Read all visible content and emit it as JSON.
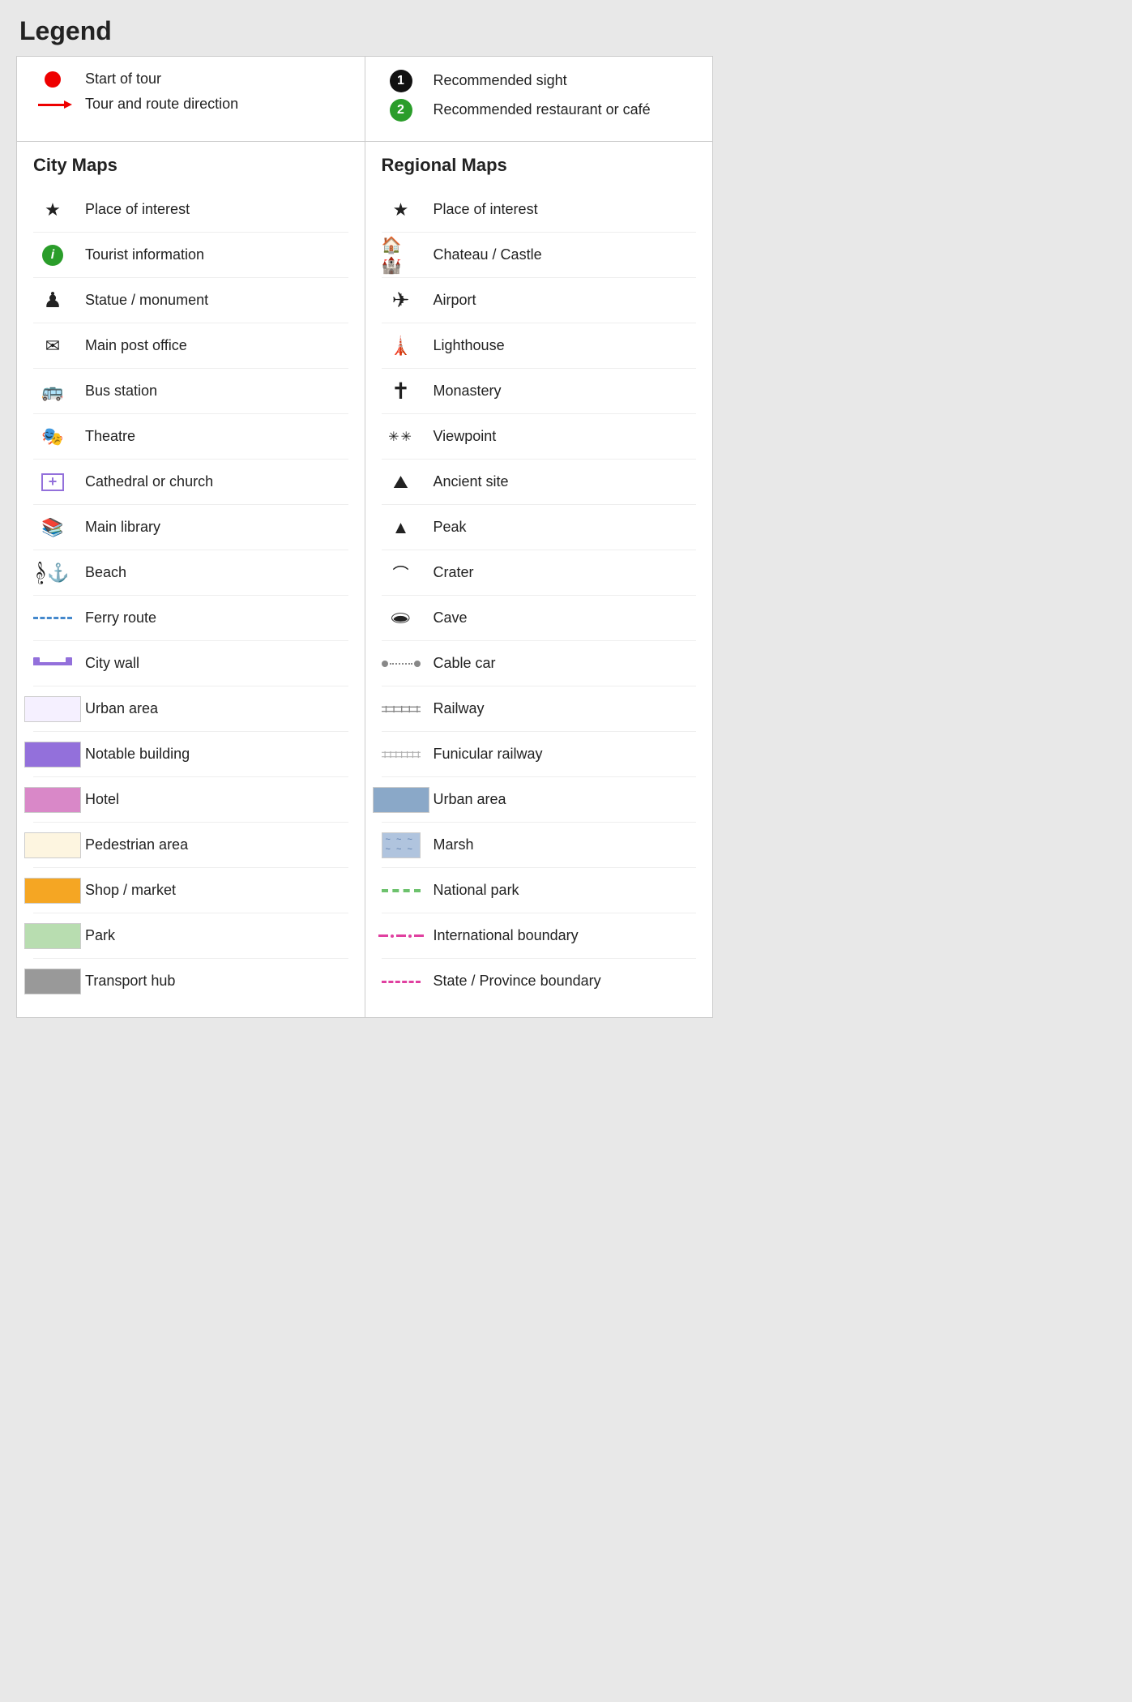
{
  "title": "Legend",
  "top": {
    "left": [
      {
        "icon": "red-dot",
        "label": "Start of tour"
      },
      {
        "icon": "red-arrow",
        "label": "Tour and route direction"
      }
    ],
    "right": [
      {
        "icon": "black-circle-1",
        "label": "Recommended sight"
      },
      {
        "icon": "green-circle-2",
        "label": "Recommended restaurant or café"
      }
    ]
  },
  "city": {
    "title": "City Maps",
    "items": [
      {
        "icon": "star",
        "label": "Place of interest"
      },
      {
        "icon": "info-green",
        "label": "Tourist information"
      },
      {
        "icon": "chess",
        "label": "Statue / monument"
      },
      {
        "icon": "envelope",
        "label": "Main post office"
      },
      {
        "icon": "bus",
        "label": "Bus station"
      },
      {
        "icon": "theatre",
        "label": "Theatre"
      },
      {
        "icon": "church-box",
        "label": "Cathedral or church"
      },
      {
        "icon": "library",
        "label": "Main library"
      },
      {
        "icon": "beach",
        "label": "Beach"
      },
      {
        "icon": "ferry",
        "label": "Ferry route"
      },
      {
        "icon": "city-wall",
        "label": "City wall"
      },
      {
        "icon": "swatch-white",
        "label": "Urban area"
      },
      {
        "icon": "swatch-purple",
        "label": "Notable building"
      },
      {
        "icon": "swatch-pink",
        "label": "Hotel"
      },
      {
        "icon": "swatch-cream",
        "label": "Pedestrian area"
      },
      {
        "icon": "swatch-orange",
        "label": "Shop / market"
      },
      {
        "icon": "swatch-green",
        "label": "Park"
      },
      {
        "icon": "swatch-gray",
        "label": "Transport hub"
      }
    ]
  },
  "regional": {
    "title": "Regional Maps",
    "items": [
      {
        "icon": "star",
        "label": "Place of interest"
      },
      {
        "icon": "castle",
        "label": "Chateau / Castle"
      },
      {
        "icon": "airport",
        "label": "Airport"
      },
      {
        "icon": "lighthouse",
        "label": "Lighthouse"
      },
      {
        "icon": "monastery",
        "label": "Monastery"
      },
      {
        "icon": "viewpoint",
        "label": "Viewpoint"
      },
      {
        "icon": "ancient",
        "label": "Ancient site"
      },
      {
        "icon": "peak",
        "label": "Peak"
      },
      {
        "icon": "crater",
        "label": "Crater"
      },
      {
        "icon": "cave",
        "label": "Cave"
      },
      {
        "icon": "cable-car",
        "label": "Cable car"
      },
      {
        "icon": "railway",
        "label": "Railway"
      },
      {
        "icon": "funicular",
        "label": "Funicular railway"
      },
      {
        "icon": "swatch-blue-gray",
        "label": "Urban area"
      },
      {
        "icon": "marsh",
        "label": "Marsh"
      },
      {
        "icon": "national-park",
        "label": "National park"
      },
      {
        "icon": "intl-boundary",
        "label": "International boundary"
      },
      {
        "icon": "state-boundary",
        "label": "State / Province boundary"
      }
    ]
  }
}
